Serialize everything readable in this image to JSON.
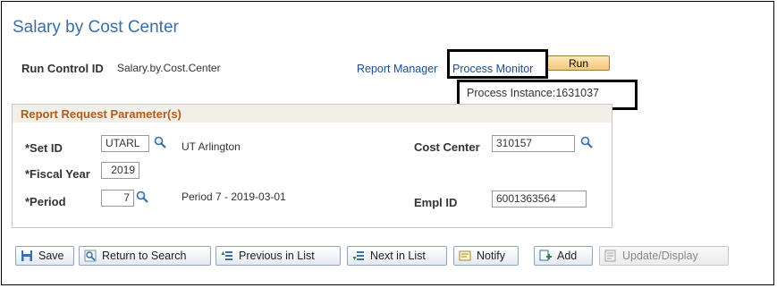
{
  "page": {
    "title": "Salary by Cost Center"
  },
  "run_control": {
    "label": "Run Control ID",
    "value": "Salary.by.Cost.Center"
  },
  "links": {
    "report_manager": "Report Manager",
    "process_monitor": "Process Monitor"
  },
  "run_button": {
    "label": "Run"
  },
  "process_instance": {
    "text": "Process Instance:1631037"
  },
  "group": {
    "title": "Report Request Parameter(s)"
  },
  "fields": {
    "set_id": {
      "label": "*Set ID",
      "value": "UTARL",
      "description": "UT Arlington"
    },
    "fiscal_year": {
      "label": "*Fiscal Year",
      "value": "2019"
    },
    "period": {
      "label": "*Period",
      "value": "7",
      "description": "Period 7 - 2019-03-01"
    },
    "cost_center": {
      "label": "Cost Center",
      "value": "310157"
    },
    "empl_id": {
      "label": "Empl ID",
      "value": "6001363564"
    }
  },
  "toolbar": {
    "save": "Save",
    "return_to_search": "Return to Search",
    "previous_in_list": "Previous in List",
    "next_in_list": "Next in List",
    "notify": "Notify",
    "add": "Add",
    "update_display": "Update/Display"
  },
  "icons": {
    "lookup": "magnifier-icon",
    "save": "floppy-icon",
    "return_to_search": "search-return-icon",
    "previous_in_list": "list-up-icon",
    "next_in_list": "list-down-icon",
    "notify": "notify-icon",
    "add": "add-icon",
    "update_display": "update-display-icon"
  },
  "colors": {
    "title": "#3a6ea5",
    "link": "#1a4d8f",
    "group_title": "#b35b1c",
    "run_button": "#f3c676"
  }
}
